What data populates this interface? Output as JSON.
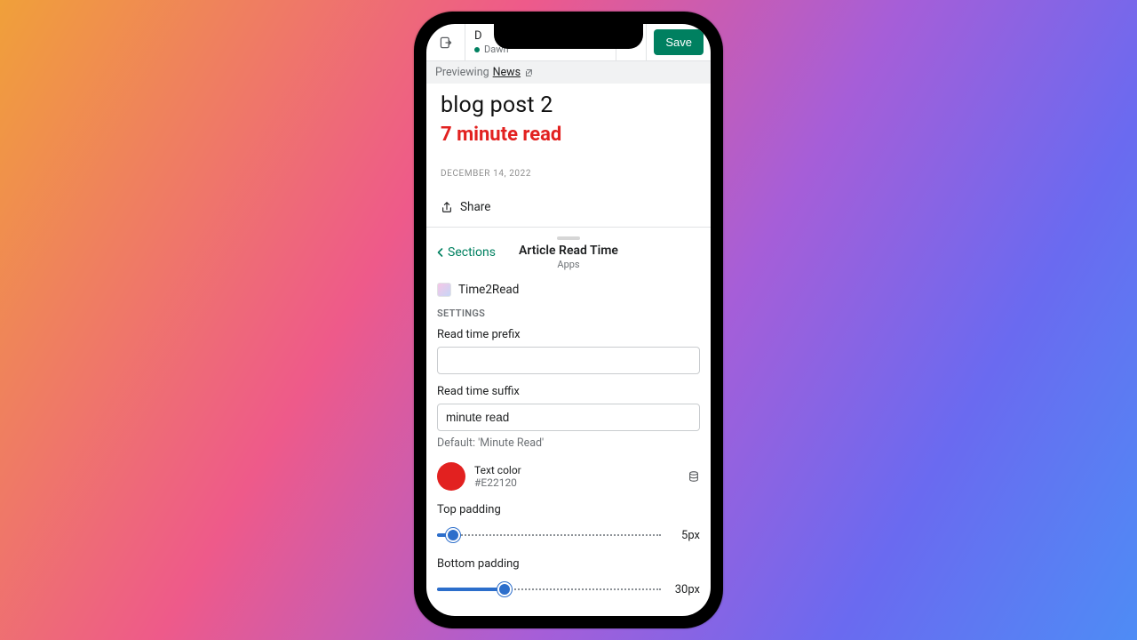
{
  "topbar": {
    "theme_initial": "D",
    "theme_name": "Dawn",
    "save_label": "Save"
  },
  "preview": {
    "label": "Previewing",
    "link_text": "News"
  },
  "article": {
    "title": "blog post 2",
    "read_time": "7 minute read",
    "date": "DECEMBER 14, 2022",
    "share_label": "Share"
  },
  "panel": {
    "back_label": "Sections",
    "title": "Article Read Time",
    "subtitle": "Apps",
    "app_name": "Time2Read",
    "settings_heading": "SETTINGS"
  },
  "settings": {
    "prefix": {
      "label": "Read time prefix",
      "value": ""
    },
    "suffix": {
      "label": "Read time suffix",
      "value": "minute read",
      "helper": "Default: 'Minute Read'"
    },
    "color": {
      "label": "Text color",
      "hex": "#E22120",
      "swatch": "#e22120"
    },
    "top_padding": {
      "label": "Top padding",
      "value_text": "5px",
      "percent": 7
    },
    "bottom_padding": {
      "label": "Bottom padding",
      "value_text": "30px",
      "percent": 30
    }
  }
}
